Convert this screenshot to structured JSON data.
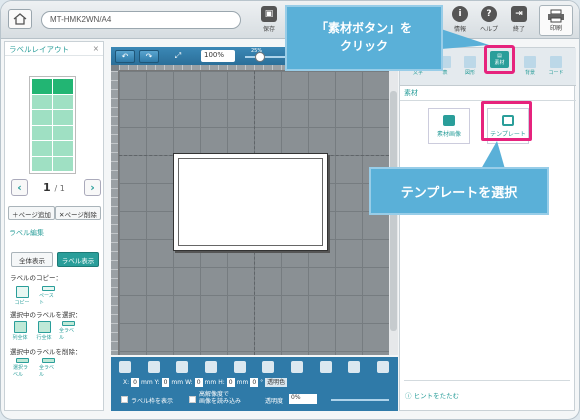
{
  "window": {
    "doc_name": "MT-HMK2WN/A4"
  },
  "toolbar": {
    "save": "保存",
    "info": "情報",
    "help": "ヘルプ",
    "exit": "終了",
    "print": "印刷"
  },
  "left_panel": {
    "title": "ラベルレイアウト",
    "page_current": "1",
    "page_total": "/ 1",
    "add_page": "＋ページ追加",
    "delete_page": "✕ページ削除",
    "label_edit_title": "ラベル編集",
    "show_all": "全体表示",
    "show_label": "ラベル表示",
    "copy_label": "ラベルのコピー：",
    "copy": "コピー",
    "paste": "ペースト",
    "select_label": "選択中のラベルを選択：",
    "select_col": "列全体",
    "select_row": "行全体",
    "select_all": "全ラベル",
    "delete_label": "選択中のラベルを削除：",
    "delete_selected": "選択ラベル",
    "delete_all": "全ラベル"
  },
  "canvas_toolbar": {
    "zoom": "100%",
    "slider_pct": "25%",
    "slider_level": 0.25
  },
  "bottom_bar": {
    "x_label": "X:",
    "x_val": "0",
    "mm": "mm",
    "y_label": "Y:",
    "y_val": "0",
    "w_label": "W:",
    "w_val": "0",
    "h_label": "H:",
    "h_val": "0",
    "deg_val": "0",
    "deg": "°",
    "transparent_color": "透明色",
    "show_frame": "ラベル枠を表示",
    "hires": "高解像度で\n画像を読み込み",
    "opacity_label": "透明度",
    "opacity_val": "0%"
  },
  "right_panel": {
    "tab_text": "文字",
    "tab_table": "表",
    "tab_shape": "図形",
    "tab_material": "素材",
    "tab_background": "背景",
    "tab_code": "コード",
    "section_title": "素材",
    "material_image": "素材画像",
    "template": "テンプレート",
    "hint": "ヒントをたたむ"
  },
  "callouts": {
    "c1_line1": "「素材ボタン」を",
    "c1_line2": "クリック",
    "c2": "テンプレートを選択"
  },
  "colors": {
    "accent": "#2a9e9a",
    "highlight": "#e6237d",
    "callout": "#5ab0d8"
  }
}
